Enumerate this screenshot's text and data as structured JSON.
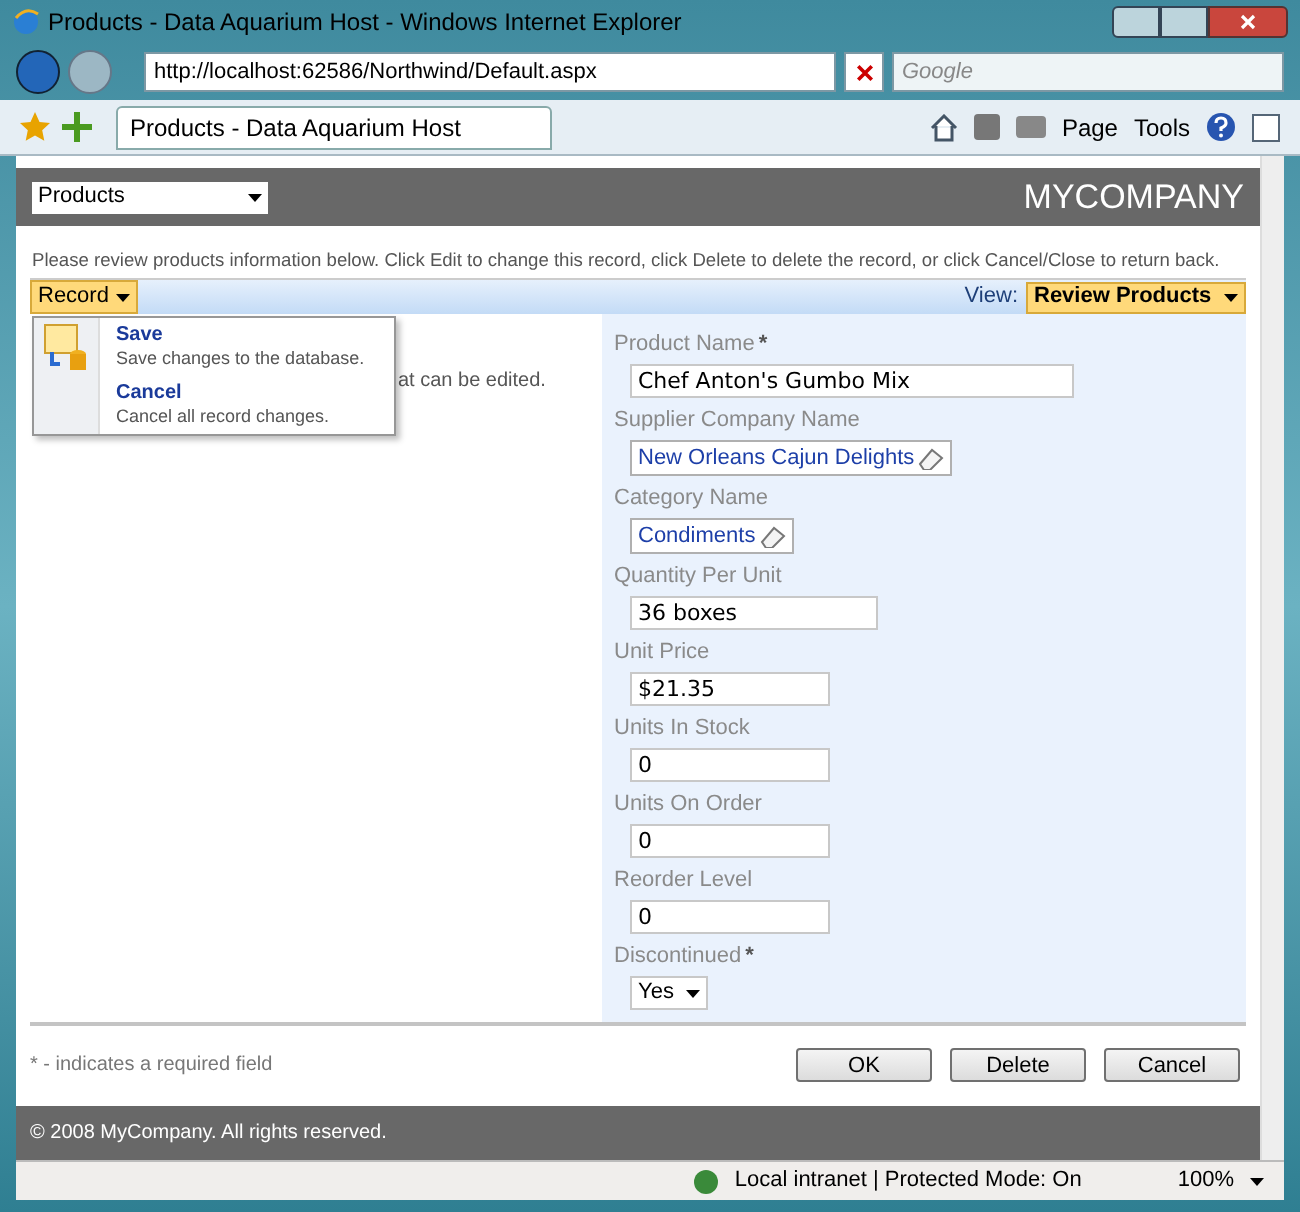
{
  "window": {
    "title": "Products - Data Aquarium Host",
    "app_name": "- Windows Internet Explorer"
  },
  "address_bar": {
    "url": "http://localhost:62586/Northwind/Default.aspx"
  },
  "search": {
    "placeholder": "Google"
  },
  "tab": {
    "label": "Products - Data Aquarium Host",
    "selected": true
  },
  "command_bar": [
    {
      "label": "Page"
    },
    {
      "label": "Tools"
    }
  ],
  "page": {
    "menu_select": "Products",
    "company": "MYCOMPANY",
    "instructions": "Please review products information below. Click Edit to change this record, click Delete to delete the record, or click Cancel/Close to return back.",
    "record_button": "Record",
    "view_label": "View:",
    "view_select": "Review Products",
    "record_menu": [
      {
        "title": "Save",
        "description": "Save changes to the database."
      },
      {
        "title": "Cancel",
        "description": "Cancel all record changes."
      }
    ],
    "left_text": "at can be edited.",
    "fields": [
      {
        "label": "Product Name",
        "required": true,
        "kind": "text",
        "value": "Chef Anton's Gumbo Mix"
      },
      {
        "label": "Supplier Company Name",
        "required": false,
        "kind": "lookup",
        "value": "New Orleans Cajun Delights"
      },
      {
        "label": "Category Name",
        "required": false,
        "kind": "lookup",
        "value": "Condiments"
      },
      {
        "label": "Quantity Per Unit",
        "required": false,
        "kind": "text",
        "value": "36 boxes"
      },
      {
        "label": "Unit Price",
        "required": false,
        "kind": "text",
        "value": "$21.35"
      },
      {
        "label": "Units In Stock",
        "required": false,
        "kind": "text",
        "value": "0"
      },
      {
        "label": "Units On Order",
        "required": false,
        "kind": "text",
        "value": "0"
      },
      {
        "label": "Reorder Level",
        "required": false,
        "kind": "text",
        "value": "0"
      },
      {
        "label": "Discontinued",
        "required": true,
        "kind": "select",
        "value": "Yes"
      }
    ],
    "required_mark": "*",
    "required_note": "* - indicates a required field",
    "buttons": [
      "OK",
      "Delete",
      "Cancel"
    ],
    "copyright": "© 2008 MyCompany. All rights reserved."
  },
  "status_bar": {
    "zone": "Local intranet | Protected Mode: On",
    "zoom": "100%"
  }
}
